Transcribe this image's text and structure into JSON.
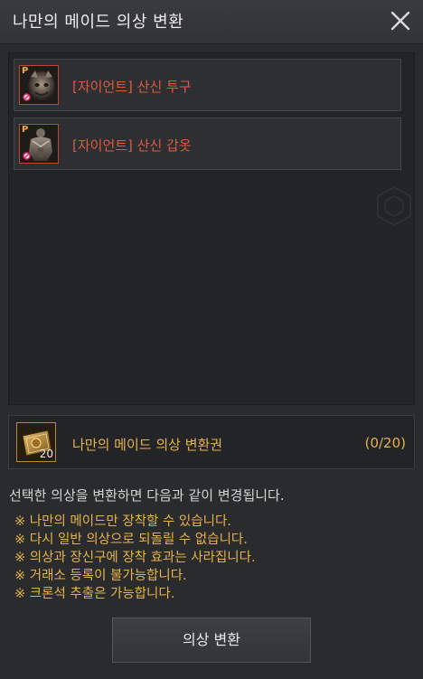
{
  "window": {
    "title": "나만의 메이드 의상 변환"
  },
  "items": [
    {
      "grade": "P",
      "name": "[자이언트] 산신 투구"
    },
    {
      "grade": "P",
      "name": "[자이언트] 산신 갑옷"
    }
  ],
  "ticket": {
    "name": "나만의 메이드 의상 변환권",
    "quantity": "20",
    "count": "(0/20)"
  },
  "description": "선택한 의상을 변환하면 다음과 같이 변경됩니다.",
  "notes": [
    "※ 나만의 메이드만 장착할 수 있습니다.",
    "※ 다시 일반 의상으로 되돌릴 수 없습니다.",
    "※ 의상과 장신구에 장착 효과는 사라집니다.",
    "※ 거래소 등록이 불가능합니다.",
    "※ 크론석 추출은 가능합니다."
  ],
  "buttons": {
    "convert": "의상 변환"
  },
  "colors": {
    "item_name": "#e05a3c",
    "accent_gold": "#e7b24a",
    "item_border": "#c0472f"
  },
  "icons": {
    "close": "close-icon",
    "item_block": "blocked-icon"
  }
}
